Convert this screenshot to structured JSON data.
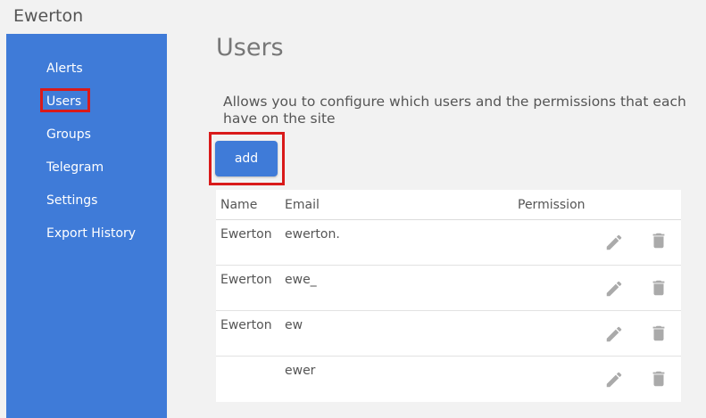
{
  "app": {
    "title": "Ewerton"
  },
  "sidebar": {
    "items": [
      {
        "label": "Alerts"
      },
      {
        "label": "Users"
      },
      {
        "label": "Groups"
      },
      {
        "label": "Telegram"
      },
      {
        "label": "Settings"
      },
      {
        "label": "Export History"
      }
    ],
    "active": "Users"
  },
  "main": {
    "title": "Users",
    "description": "Allows you to configure which users and the permissions that each have on the site",
    "add_label": "add",
    "table": {
      "headers": [
        "Name",
        "Email",
        "Permission"
      ],
      "rows": [
        {
          "name": "Ewerton",
          "email": "ewerton.",
          "permission": ""
        },
        {
          "name": "Ewerton",
          "email": "ewe_",
          "permission": ""
        },
        {
          "name": "Ewerton",
          "email": "ew",
          "permission": ""
        },
        {
          "name": "",
          "email": "ewer",
          "permission": ""
        }
      ]
    }
  },
  "colors": {
    "sidebar": "#3f7bd8",
    "button": "#3f7bd8",
    "highlight": "#d91a1a",
    "icon": "#aaaaaa"
  },
  "icons": {
    "edit": "pencil-icon",
    "delete": "trash-icon"
  }
}
